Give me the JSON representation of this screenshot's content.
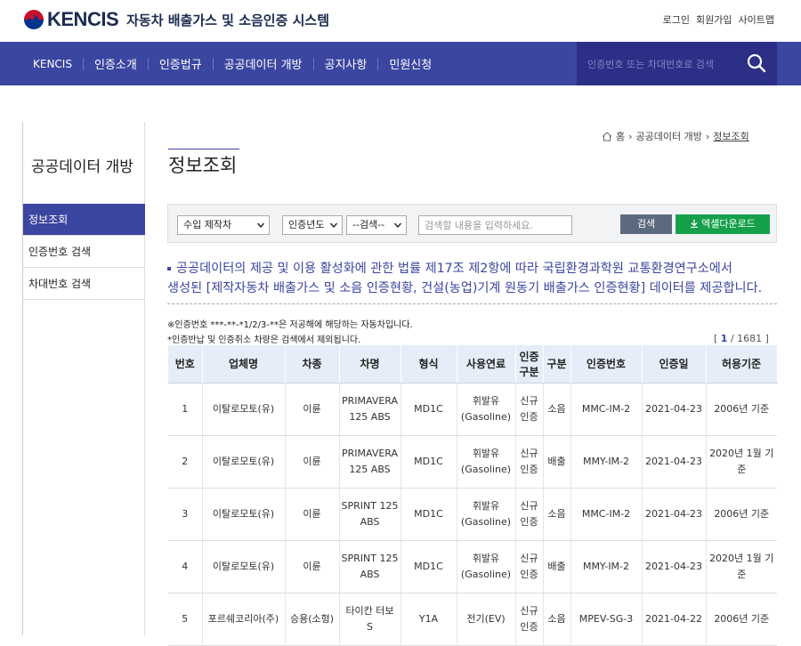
{
  "header": {
    "logo_text": "KENCIS",
    "logo_sub": "자동차 배출가스 및 소음인증 시스템",
    "links": [
      "로그인",
      "회원가입",
      "사이트맵"
    ]
  },
  "nav": {
    "items": [
      "KENCIS",
      "인증소개",
      "인증법규",
      "공공데이터 개방",
      "공지사항",
      "민원신청"
    ],
    "search_placeholder": "인증번호 또는 차대번호로 검색"
  },
  "sidebar": {
    "title": "공공데이터 개방",
    "items": [
      "정보조회",
      "인증번호 검색",
      "차대번호 검색"
    ],
    "active_index": 0
  },
  "breadcrumb": {
    "home": "홈",
    "mid": "공공데이터 개방",
    "current": "정보조회"
  },
  "page_title": "정보조회",
  "filter": {
    "type_select": "수입 제작차",
    "year_select": "인증년도",
    "field_select": "--검색--",
    "input_placeholder": "검색할 내용을 입력하세요.",
    "search_label": "검색",
    "excel_label": "엑셀다운로드"
  },
  "notice": {
    "line1": "공공데이터의 제공 및 이용 활성화에 관한 법률 제17조 제2항에 따라 국립환경과학원 교통환경연구소에서",
    "line2": "생성된 [제작자동차 배출가스 및 소음 인증현황, 건설(농업)기계 원동기 배출가스 인증현황] 데이터를 제공합니다."
  },
  "notes": {
    "note1": "※인증번호 ***-**-*1/2/3-**은 저공해에 해당하는 자동차입니다.",
    "note2": "*인증반납 및 인증취소 차량은 검색에서 제외됩니다."
  },
  "pager": {
    "current": "1",
    "total": "/ 1681",
    "open": "[",
    "close": "]"
  },
  "table": {
    "headers": [
      "번호",
      "업체명",
      "차종",
      "차명",
      "형식",
      "사용연료",
      "인증구분",
      "구분",
      "인증번호",
      "인증일",
      "허용기준"
    ],
    "rows": [
      [
        "1",
        "이탈로모토(유)",
        "이륜",
        "PRIMAVERA 125 ABS",
        "MD1C",
        "휘발유(Gasoline)",
        "신규인증",
        "소음",
        "MMC-IM-2",
        "2021-04-23",
        "2006년 기준"
      ],
      [
        "2",
        "이탈로모토(유)",
        "이륜",
        "PRIMAVERA 125 ABS",
        "MD1C",
        "휘발유(Gasoline)",
        "신규인증",
        "배출",
        "MMY-IM-2",
        "2021-04-23",
        "2020년 1월 기준"
      ],
      [
        "3",
        "이탈로모토(유)",
        "이륜",
        "SPRINT 125 ABS",
        "MD1C",
        "휘발유(Gasoline)",
        "신규인증",
        "소음",
        "MMC-IM-2",
        "2021-04-23",
        "2006년 기준"
      ],
      [
        "4",
        "이탈로모토(유)",
        "이륜",
        "SPRINT 125 ABS",
        "MD1C",
        "휘발유(Gasoline)",
        "신규인증",
        "배출",
        "MMY-IM-2",
        "2021-04-23",
        "2020년 1월 기준"
      ],
      [
        "5",
        "포르쉐코리아(주)",
        "승용(소형)",
        "타이칸 터보 S",
        "Y1A",
        "전기(EV)",
        "신규인증",
        "소음",
        "MPEV-SG-3",
        "2021-04-22",
        "2006년 기준"
      ]
    ]
  },
  "colors": {
    "nav_bg": "#3b46a0",
    "search_bg": "#2b2f86",
    "excel_green": "#15a04a",
    "table_header": "#e5eef8"
  }
}
